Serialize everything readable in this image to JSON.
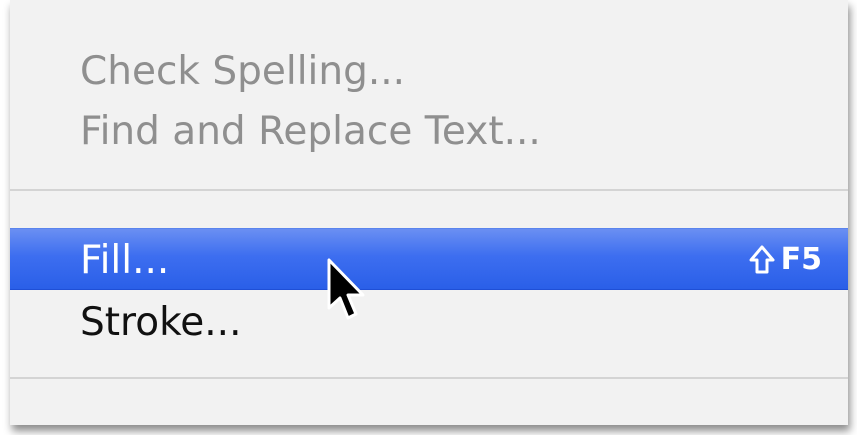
{
  "menu": {
    "items": [
      {
        "label": "Check Spelling...",
        "enabled": false
      },
      {
        "label": "Find and Replace Text...",
        "enabled": false
      },
      {
        "label": "Fill...",
        "enabled": true,
        "highlighted": true,
        "shortcut_key": "F5",
        "shortcut_modifier": "shift-icon"
      },
      {
        "label": "Stroke...",
        "enabled": true
      }
    ]
  },
  "colors": {
    "highlight": "#3d6ef0",
    "disabled_text": "#8f8f8f",
    "menu_background": "#f2f2f2"
  }
}
